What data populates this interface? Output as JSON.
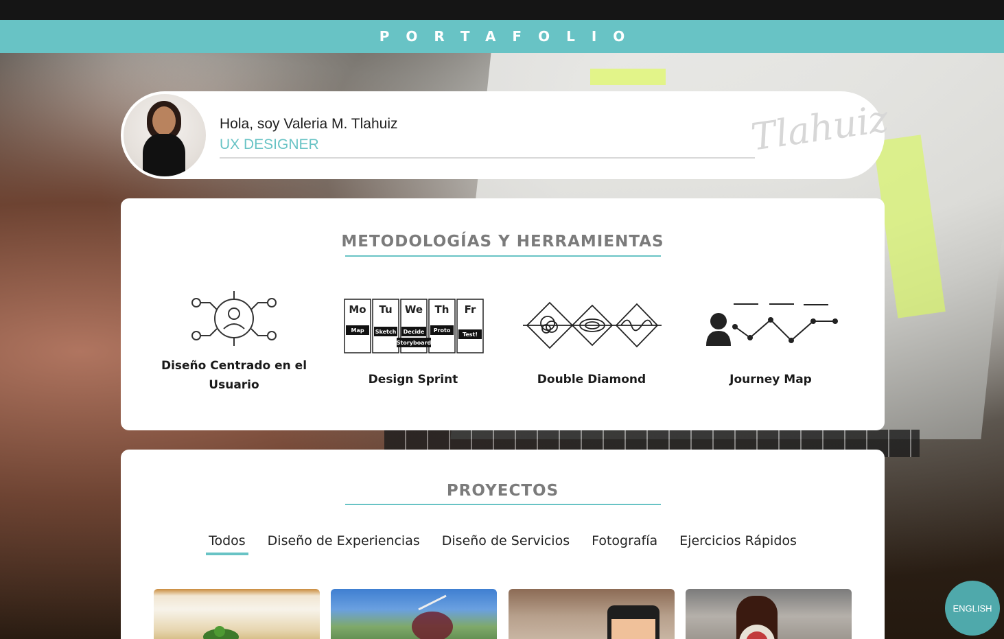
{
  "header": {
    "title": "PORTAFOLIO"
  },
  "profile": {
    "greeting": "Hola, soy Valeria M. Tlahuiz",
    "role": "UX DESIGNER",
    "signature": "Tlahuiz"
  },
  "methods": {
    "title": "METODOLOGÍAS Y HERRAMIENTAS",
    "items": [
      {
        "label": "Diseño Centrado en el Usuario",
        "icon": "user-centered-icon"
      },
      {
        "label": "Design Sprint",
        "icon": "design-sprint-icon"
      },
      {
        "label": "Double Diamond",
        "icon": "double-diamond-icon"
      },
      {
        "label": "Journey Map",
        "icon": "journey-map-icon"
      }
    ],
    "sprint_days": [
      "Mo",
      "Tu",
      "We",
      "Th",
      "Fr"
    ],
    "sprint_steps": [
      "Map",
      "Sketch",
      "Decide",
      "Proto",
      "Test!"
    ],
    "sprint_extra": "Storyboard"
  },
  "projects": {
    "title": "PROYECTOS",
    "tabs": [
      {
        "label": "Todos",
        "active": true
      },
      {
        "label": "Diseño de Experiencias",
        "active": false
      },
      {
        "label": "Diseño de Servicios",
        "active": false
      },
      {
        "label": "Fotografía",
        "active": false
      },
      {
        "label": "Ejercicios Rápidos",
        "active": false
      }
    ]
  },
  "language_button": {
    "label": "ENGLISH"
  },
  "colors": {
    "accent": "#68c3c5",
    "title_gray": "#7b7b7b"
  }
}
